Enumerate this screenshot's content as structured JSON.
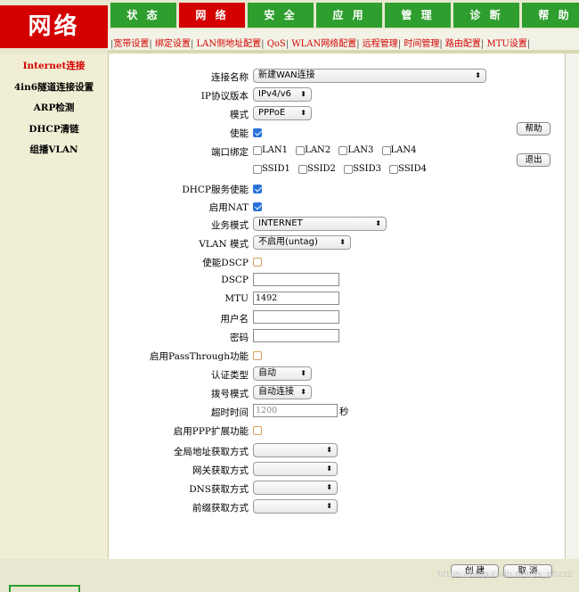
{
  "logo": {
    "title": "网络"
  },
  "tabs": [
    {
      "label": "状 态",
      "active": false
    },
    {
      "label": "网 络",
      "active": true
    },
    {
      "label": "安 全",
      "active": false
    },
    {
      "label": "应 用",
      "active": false
    },
    {
      "label": "管 理",
      "active": false
    },
    {
      "label": "诊 断",
      "active": false
    },
    {
      "label": "帮 助",
      "active": false
    }
  ],
  "subnav": [
    "宽带设置",
    "绑定设置",
    "LAN侧地址配置",
    "QoS",
    "WLAN网络配置",
    "远程管理",
    "时间管理",
    "路由配置",
    "MTU设置"
  ],
  "sidebar": {
    "items": [
      {
        "label": "Internet连接",
        "active": true
      },
      {
        "label": "4in6隧道连接设置",
        "active": false
      },
      {
        "label": "ARP检测",
        "active": false
      },
      {
        "label": "DHCP清链",
        "active": false
      },
      {
        "label": "组播VLAN",
        "active": false
      }
    ]
  },
  "form": {
    "conn_name": {
      "label": "连接名称",
      "value": "新建WAN连接"
    },
    "ip_version": {
      "label": "IP协议版本",
      "value": "IPv4/v6"
    },
    "mode": {
      "label": "模式",
      "value": "PPPoE"
    },
    "enable": {
      "label": "使能",
      "checked": true
    },
    "port_bind": {
      "label": "端口绑定",
      "lan": [
        "LAN1",
        "LAN2",
        "LAN3",
        "LAN4"
      ],
      "ssid": [
        "SSID1",
        "SSID2",
        "SSID3",
        "SSID4"
      ]
    },
    "dhcp_enable": {
      "label": "DHCP服务使能",
      "checked": true
    },
    "nat": {
      "label": "启用NAT",
      "checked": true
    },
    "service_mode": {
      "label": "业务模式",
      "value": "INTERNET"
    },
    "vlan_mode": {
      "label": "VLAN 模式",
      "value": "不启用(untag)"
    },
    "enable_dscp": {
      "label": "使能DSCP",
      "checked": false
    },
    "dscp": {
      "label": "DSCP",
      "value": ""
    },
    "mtu": {
      "label": "MTU",
      "value": "1492"
    },
    "username": {
      "label": "用户名",
      "value": ""
    },
    "password": {
      "label": "密码",
      "value": ""
    },
    "passthrough": {
      "label": "启用PassThrough功能",
      "checked": false
    },
    "auth_type": {
      "label": "认证类型",
      "value": "自动"
    },
    "dial_mode": {
      "label": "拨号模式",
      "value": "自动连接"
    },
    "timeout": {
      "label": "超时时间",
      "value": "1200",
      "unit": "秒"
    },
    "ppp_ext": {
      "label": "启用PPP扩展功能",
      "checked": false
    },
    "global_addr": {
      "label": "全局地址获取方式",
      "value": ""
    },
    "gateway": {
      "label": "网关获取方式",
      "value": ""
    },
    "dns": {
      "label": "DNS获取方式",
      "value": ""
    },
    "prefix": {
      "label": "前缀获取方式",
      "value": ""
    }
  },
  "buttons": {
    "help": "帮助",
    "logout": "退出",
    "create": "创 建",
    "cancel": "取 消"
  },
  "watermark": "https://blog.csdn.net/zs_phzzz",
  "icons": {
    "select_arrow": "⬍"
  }
}
